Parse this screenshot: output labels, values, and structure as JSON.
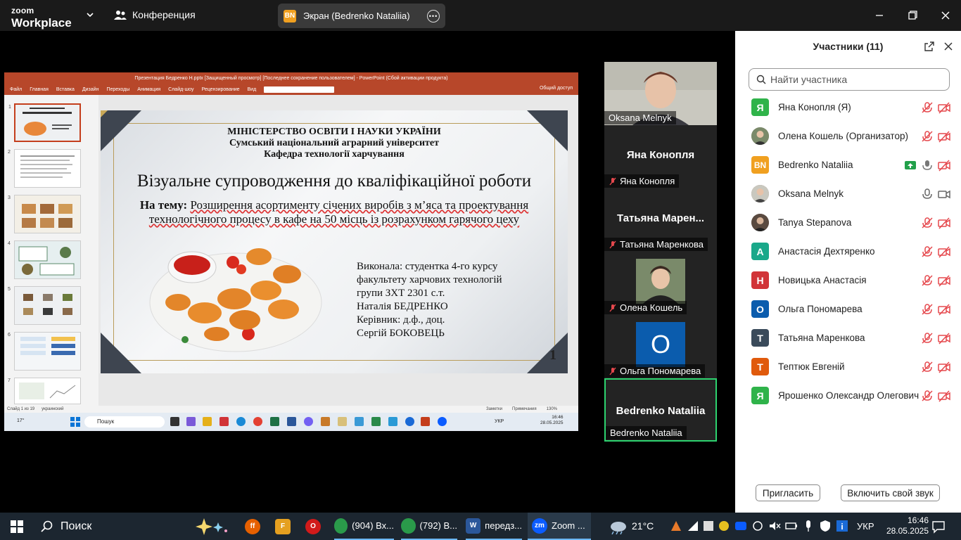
{
  "zoom": {
    "logo_line1": "zoom",
    "logo_line2": "Workplace",
    "meeting_label": "Конференция",
    "screen_badge": "BN",
    "screen_label": "Экран (Bedrenko Nataliia)"
  },
  "ppt": {
    "titlebar": "Презентация Бедренко Н.pptx [Защищенный просмотр] [Последнее сохранение пользователем] - PowerPoint (Сбой активации продукта)",
    "tabs": [
      "Файл",
      "Главная",
      "Вставка",
      "Дизайн",
      "Переходы",
      "Анимация",
      "Слайд-шоу",
      "Рецензирование",
      "Вид"
    ],
    "share": "Общий доступ",
    "thumb_numbers": [
      "1",
      "2",
      "3",
      "4",
      "5",
      "6",
      "7"
    ],
    "status_left": "Слайд 1 из 19",
    "status_lang": "украинский",
    "status_notes": "Заметки",
    "status_comments": "Примечания",
    "zoom_pct": "130%"
  },
  "slide": {
    "ministry_1": "МІНІСТЕРСТВО ОСВІТИ І НАУКИ УКРАЇНИ",
    "ministry_2": "Сумський національний аграрний університет",
    "ministry_3": "Кафедра технології харчування",
    "title": "Візуальне супроводження до кваліфікаційної роботи",
    "theme_prefix": "На тему:",
    "theme_text": "Розширення асортименту січених виробів з м’яса та проектування технологічного процесу в кафе на 50 місць із розрахунком гарячого цеху",
    "author_lines": [
      "Виконала: студентка 4-го курсу",
      "факультету харчових технологій",
      "групи ЗХТ 2301 с.т.",
      "Наталія БЕДРЕНКО",
      "Керівник: д.ф., доц.",
      "Сергій БОКОВЕЦЬ"
    ],
    "page_number": "1"
  },
  "inner_taskbar": {
    "temp": "17°",
    "search": "Пошук",
    "lang": "УКР",
    "time": "16:46",
    "date": "28.05.2025"
  },
  "tiles": {
    "t1_name": "Oksana Melnyk",
    "t2_big": "Яна Конопля",
    "t2_name": "Яна Конопля",
    "t3_big": "Татьяна  Марен...",
    "t3_name": "Татьяна Маренкова",
    "t4_name": "Олена Кошель",
    "t5_avatar": "О",
    "t5_name": "Ольга Пономарева",
    "t6_big": "Bedrenko Nataliia",
    "t6_name": "Bedrenko Nataliia"
  },
  "panel": {
    "title": "Участники (11)",
    "search_placeholder": "Найти участника",
    "participants": [
      {
        "initial": "Я",
        "name": "Яна Конопля (Я)",
        "color": "#2fb34a",
        "photo": false
      },
      {
        "initial": "",
        "name": "Олена Кошель (Организатор)",
        "color": "#8a7a70",
        "photo": true
      },
      {
        "initial": "BN",
        "name": "Bedrenko Nataliia",
        "color": "#f0a020",
        "photo": false
      },
      {
        "initial": "",
        "name": "Oksana Melnyk",
        "color": "#8a7a70",
        "photo": true
      },
      {
        "initial": "",
        "name": "Tanya Stepanova",
        "color": "#5a4a40",
        "photo": true
      },
      {
        "initial": "А",
        "name": "Анастасія Дехтяренко",
        "color": "#1aa88a",
        "photo": false
      },
      {
        "initial": "Н",
        "name": "Новицька Анастасія",
        "color": "#d13438",
        "photo": false
      },
      {
        "initial": "О",
        "name": "Ольга Пономарева",
        "color": "#0b5cad",
        "photo": false
      },
      {
        "initial": "Т",
        "name": "Татьяна Маренкова",
        "color": "#3a4a5a",
        "photo": false
      },
      {
        "initial": "Т",
        "name": "Тептюк Евгеній",
        "color": "#e05a0c",
        "photo": false
      },
      {
        "initial": "Я",
        "name": "Ярошенко Олександр Олегович",
        "color": "#2fb34a",
        "photo": false
      }
    ],
    "invite": "Пригласить",
    "unmute": "Включить свой звук"
  },
  "taskbar": {
    "search": "Поиск",
    "items": [
      "(904) Вх...",
      "(792) В...",
      "передз...",
      "Zoom ..."
    ],
    "weather": "21°C",
    "lang": "УКР",
    "time": "16:46",
    "date": "28.05.2025"
  },
  "colors": {
    "zoom_bg": "#1a1a1a",
    "ppt_red": "#b7472a",
    "active_green": "#2dd36f",
    "muted_red": "#e5484d"
  }
}
